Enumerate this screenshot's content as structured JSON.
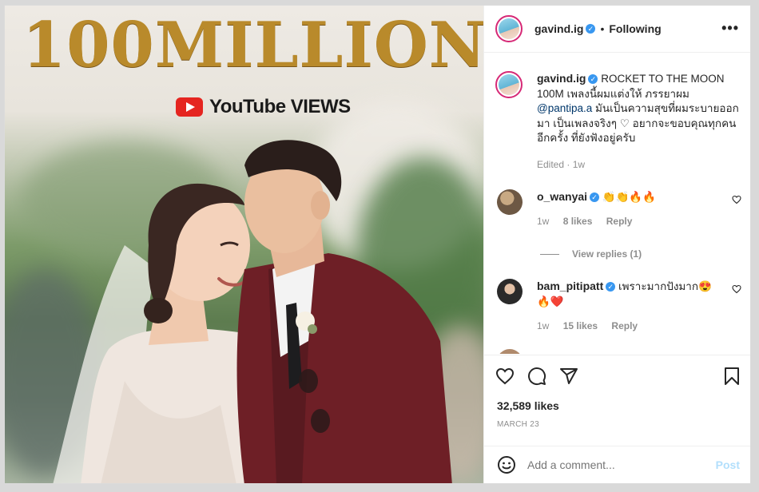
{
  "post_image": {
    "headline": "100MILLION",
    "badge_text": "YouTube VIEWS"
  },
  "header": {
    "username": "gavind.ig",
    "separator": "•",
    "follow_status": "Following",
    "more_glyph": "•••"
  },
  "caption": {
    "username": "gavind.ig",
    "text_before_mention": "ROCKET TO THE MOON 100M เพลงนี้ผมแต่งให้ ภรรยาผม",
    "mention": "@pantipa.a",
    "text_after_mention": "มันเป็นความสุขที่ผมระบายออกมา เป็นเพลงจริงๆ ♡ อยากจะขอบคุณทุกคนอีกครั้ง ที่ยังฟังอยู่ครับ",
    "meta": "Edited · 1w"
  },
  "comments": [
    {
      "username": "o_wanyai",
      "text": "👏👏🔥🔥",
      "age": "1w",
      "likes": "8 likes",
      "reply_label": "Reply"
    },
    {
      "username": "bam_pitipatt",
      "text": "เพราะมากปังมาก😍🔥❤️",
      "age": "1w",
      "likes": "15 likes",
      "reply_label": "Reply"
    }
  ],
  "view_replies": "View replies (1)",
  "stats": {
    "likes": "32,589 likes",
    "date": "MARCH 23"
  },
  "add_comment": {
    "placeholder": "Add a comment...",
    "post_label": "Post"
  },
  "colors": {
    "verified": "#3897f0",
    "link": "#00376b",
    "post_disabled": "#b2dffc",
    "youtube_red": "#e52520",
    "headline_gold": "#b98a2b"
  },
  "icons": [
    "verified-badge-icon",
    "more-options-icon",
    "like-icon",
    "comment-icon",
    "share-icon",
    "save-icon",
    "emoji-icon",
    "heart-small-icon"
  ]
}
